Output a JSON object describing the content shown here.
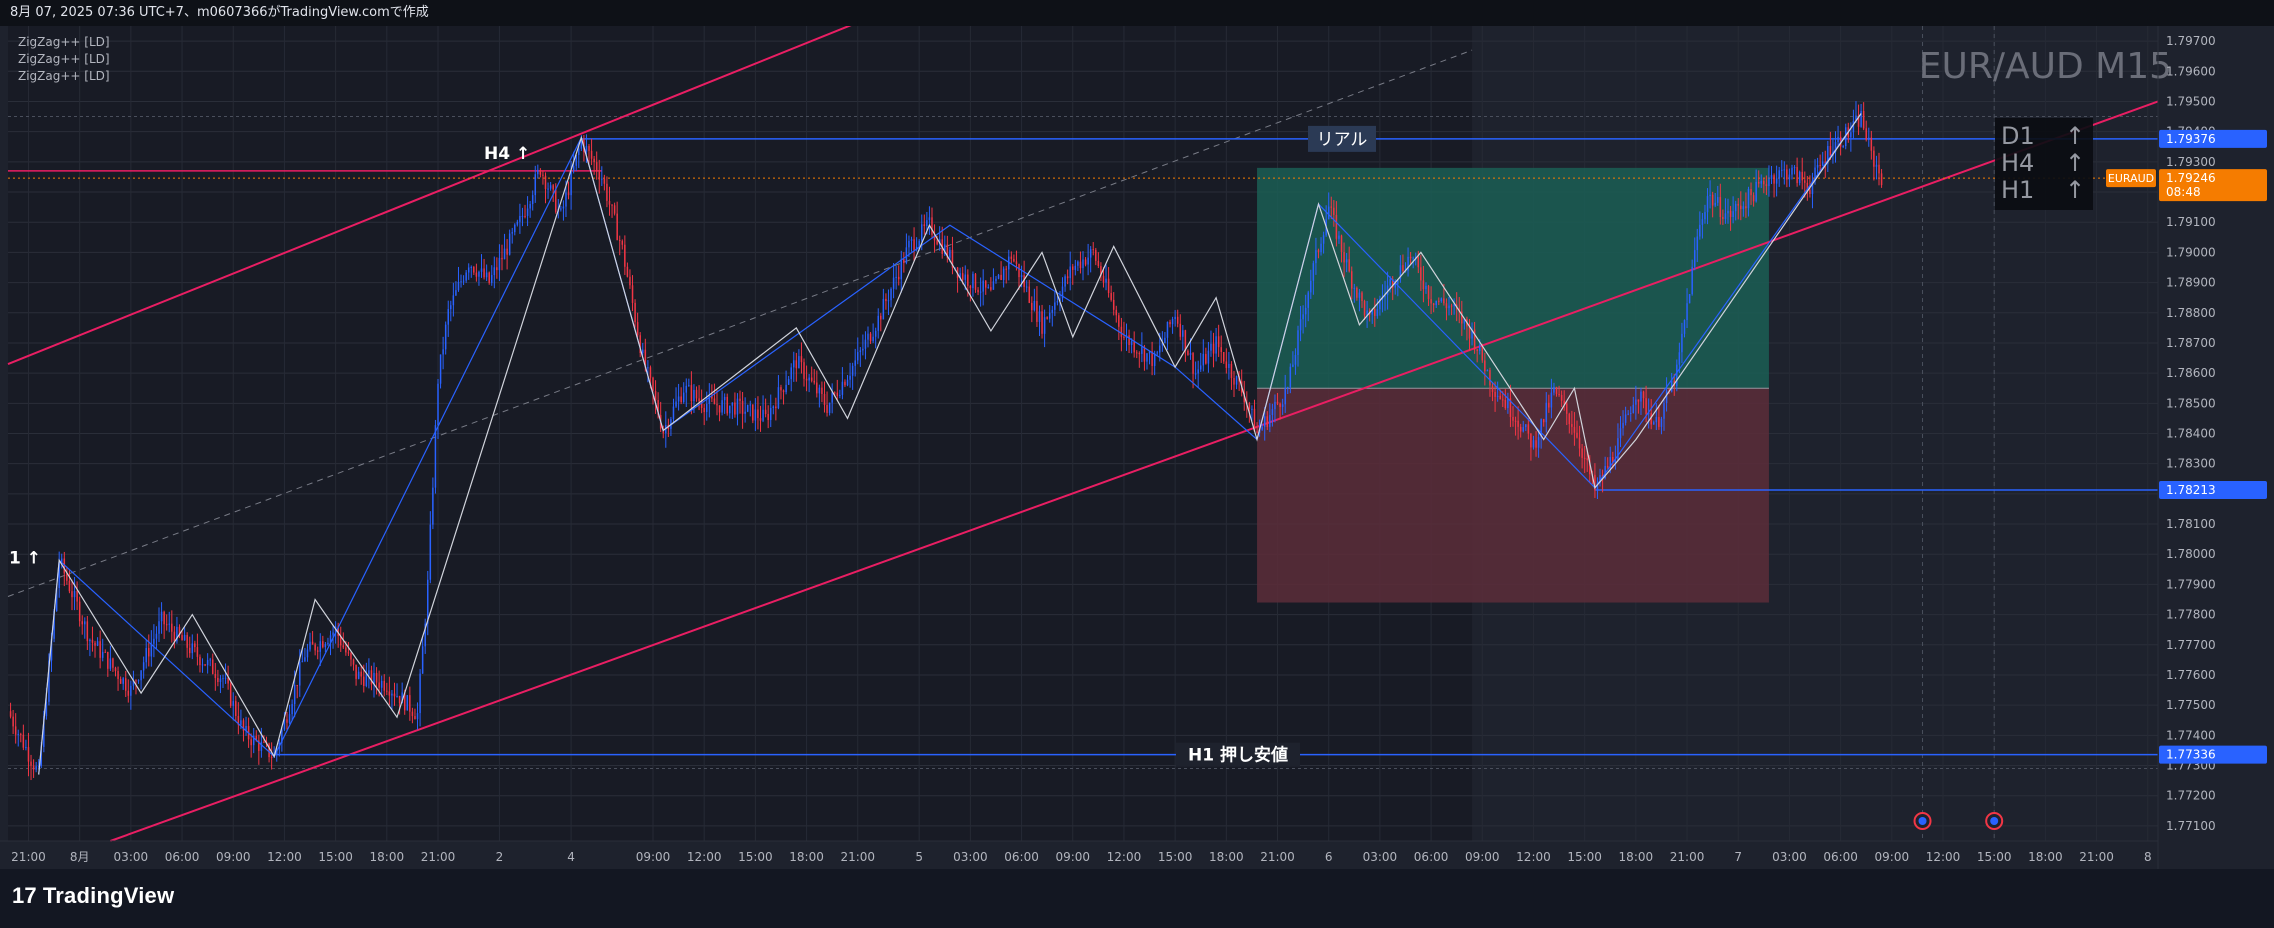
{
  "header": {
    "caption": "8月 07, 2025 07:36 UTC+7、m0607366がTradingView.comで作成"
  },
  "footer": {
    "brand": "TradingView",
    "brand_mark": "17"
  },
  "colors": {
    "background": "#1e222d",
    "up_candle": "#2962ff",
    "down_candle": "#f23645",
    "channel": "#e91e63",
    "zigzag_white": "#d1d4dc",
    "zigzag_blue": "#2962ff",
    "profit_zone": "#1b5e55",
    "loss_zone": "#5c2d3a",
    "price_tag_blue": "#2962ff",
    "price_tag_orange": "#f57c00"
  },
  "indicators": [
    "ZigZag++ [LD]",
    "ZigZag++ [LD]",
    "ZigZag++ [LD]"
  ],
  "watermark": "EUR/AUD M15",
  "trend_box": {
    "rows": [
      {
        "tf": "D1",
        "arrow": "↑"
      },
      {
        "tf": "H4",
        "arrow": "↑"
      },
      {
        "tf": "H1",
        "arrow": "↑"
      }
    ]
  },
  "annotations": {
    "h4_label": "H4 ↑",
    "h1_label_partial": "1 ↑",
    "real_label": "リアル",
    "support_label": "H1 押し安値"
  },
  "price_tags": {
    "h4_high": "1.79376",
    "current_symbol": "EURAUD",
    "current_price": "1.79246",
    "countdown": "08:48",
    "swing_low": "1.78213",
    "support": "1.77336"
  },
  "chart_data": {
    "type": "candlestick",
    "symbol": "EURAUD",
    "timeframe": "M15",
    "ylim": [
      1.7705,
      1.7975
    ],
    "y_ticks": [
      "1.79700",
      "1.79600",
      "1.79500",
      "1.79400",
      "1.79300",
      "1.79200",
      "1.79100",
      "1.79000",
      "1.78900",
      "1.78800",
      "1.78700",
      "1.78600",
      "1.78500",
      "1.78400",
      "1.78300",
      "1.78200",
      "1.78100",
      "1.78000",
      "1.77900",
      "1.77800",
      "1.77700",
      "1.77600",
      "1.77500",
      "1.77400",
      "1.77300",
      "1.77200",
      "1.77100"
    ],
    "x_ticks": [
      "21:00",
      "8月",
      "03:00",
      "06:00",
      "09:00",
      "12:00",
      "15:00",
      "18:00",
      "21:00",
      "2",
      "4",
      "09:00",
      "12:00",
      "15:00",
      "18:00",
      "21:00",
      "5",
      "03:00",
      "06:00",
      "09:00",
      "12:00",
      "15:00",
      "18:00",
      "21:00",
      "6",
      "03:00",
      "06:00",
      "09:00",
      "12:00",
      "15:00",
      "18:00",
      "21:00",
      "7",
      "03:00",
      "06:00",
      "09:00",
      "12:00",
      "15:00",
      "18:00",
      "21:00",
      "8"
    ],
    "x_tick_slots": [
      2,
      7,
      12,
      17,
      22,
      27,
      32,
      37,
      42,
      48,
      55,
      63,
      68,
      73,
      78,
      83,
      89,
      94,
      99,
      104,
      109,
      114,
      119,
      124,
      129,
      134,
      139,
      144,
      149,
      154,
      159,
      164,
      169,
      174,
      179,
      184,
      189,
      194,
      199,
      204,
      209
    ],
    "n_slots": 210,
    "price_path": [
      [
        0,
        1.7748
      ],
      [
        3,
        1.7727
      ],
      [
        5,
        1.7798
      ],
      [
        8,
        1.7772
      ],
      [
        12,
        1.7755
      ],
      [
        15,
        1.7778
      ],
      [
        18,
        1.7768
      ],
      [
        21,
        1.7759
      ],
      [
        23,
        1.7741
      ],
      [
        26,
        1.7733
      ],
      [
        29,
        1.7767
      ],
      [
        32,
        1.7775
      ],
      [
        34,
        1.776
      ],
      [
        37,
        1.7757
      ],
      [
        40,
        1.7747
      ],
      [
        41,
        1.779
      ],
      [
        42,
        1.7858
      ],
      [
        43,
        1.788
      ],
      [
        45,
        1.7897
      ],
      [
        47,
        1.789
      ],
      [
        50,
        1.791
      ],
      [
        52,
        1.7928
      ],
      [
        54,
        1.7912
      ],
      [
        56,
        1.7937
      ],
      [
        58,
        1.7925
      ],
      [
        60,
        1.7901
      ],
      [
        62,
        1.7865
      ],
      [
        64,
        1.7841
      ],
      [
        66,
        1.7855
      ],
      [
        68,
        1.785
      ],
      [
        71,
        1.7849
      ],
      [
        74,
        1.7845
      ],
      [
        77,
        1.7864
      ],
      [
        80,
        1.7849
      ],
      [
        83,
        1.7865
      ],
      [
        85,
        1.7878
      ],
      [
        88,
        1.7902
      ],
      [
        90,
        1.7909
      ],
      [
        93,
        1.7893
      ],
      [
        96,
        1.7886
      ],
      [
        98,
        1.7899
      ],
      [
        101,
        1.7876
      ],
      [
        104,
        1.7895
      ],
      [
        106,
        1.79
      ],
      [
        109,
        1.7872
      ],
      [
        112,
        1.7864
      ],
      [
        114,
        1.788
      ],
      [
        116,
        1.786
      ],
      [
        118,
        1.787
      ],
      [
        121,
        1.7851
      ],
      [
        122,
        1.784
      ],
      [
        125,
        1.7855
      ],
      [
        127,
        1.7888
      ],
      [
        129,
        1.7915
      ],
      [
        131,
        1.7893
      ],
      [
        133,
        1.7877
      ],
      [
        135,
        1.789
      ],
      [
        137,
        1.7899
      ],
      [
        139,
        1.7885
      ],
      [
        141,
        1.7882
      ],
      [
        143,
        1.7873
      ],
      [
        145,
        1.7856
      ],
      [
        147,
        1.7847
      ],
      [
        149,
        1.7836
      ],
      [
        151,
        1.7854
      ],
      [
        153,
        1.7842
      ],
      [
        155,
        1.7821
      ],
      [
        157,
        1.7834
      ],
      [
        159,
        1.7854
      ],
      [
        161,
        1.7843
      ],
      [
        163,
        1.786
      ],
      [
        165,
        1.7905
      ],
      [
        166,
        1.7919
      ],
      [
        168,
        1.7912
      ],
      [
        170,
        1.7918
      ],
      [
        172,
        1.7925
      ],
      [
        174,
        1.7927
      ],
      [
        176,
        1.7922
      ],
      [
        178,
        1.7935
      ],
      [
        180,
        1.794
      ],
      [
        181,
        1.7945
      ],
      [
        182,
        1.7932
      ],
      [
        183,
        1.7925
      ]
    ],
    "zigzag_white": [
      [
        3,
        1.7727
      ],
      [
        5,
        1.7798
      ],
      [
        13,
        1.7754
      ],
      [
        18,
        1.778
      ],
      [
        26,
        1.7733
      ],
      [
        30,
        1.7785
      ],
      [
        38,
        1.7746
      ],
      [
        56,
        1.7938
      ],
      [
        64,
        1.7841
      ],
      [
        77,
        1.7875
      ],
      [
        82,
        1.7845
      ],
      [
        90,
        1.7909
      ],
      [
        96,
        1.7874
      ],
      [
        101,
        1.79
      ],
      [
        104,
        1.7872
      ],
      [
        108,
        1.7902
      ],
      [
        114,
        1.7862
      ],
      [
        118,
        1.7885
      ],
      [
        122,
        1.7838
      ],
      [
        128,
        1.7916
      ],
      [
        132,
        1.7876
      ],
      [
        138,
        1.79
      ],
      [
        150,
        1.7838
      ],
      [
        153,
        1.7855
      ],
      [
        155,
        1.7822
      ],
      [
        159,
        1.7838
      ],
      [
        181,
        1.7946
      ]
    ],
    "zigzag_blue": [
      [
        3,
        1.7727
      ],
      [
        5,
        1.7798
      ],
      [
        26,
        1.7733
      ],
      [
        56,
        1.7938
      ],
      [
        64,
        1.7841
      ],
      [
        92,
        1.7909
      ],
      [
        114,
        1.7862
      ],
      [
        122,
        1.7838
      ],
      [
        128,
        1.7916
      ],
      [
        155,
        1.7822
      ],
      [
        181,
        1.7946
      ]
    ],
    "channel_upper": [
      [
        0,
        1.7863
      ],
      [
        88,
        1.7983
      ]
    ],
    "channel_lower": [
      [
        10,
        1.7705
      ],
      [
        210,
        1.795
      ]
    ],
    "channel_mid": [
      [
        0,
        1.7786
      ],
      [
        143,
        1.7967
      ]
    ],
    "position_box": {
      "x_start": 122,
      "x_end": 172,
      "entry": 1.7855,
      "target": 1.7928,
      "stop": 1.7784
    },
    "levels": [
      {
        "name": "h4_high",
        "value": 1.79376,
        "x_start": 56
      },
      {
        "name": "swing_low",
        "value": 1.78213,
        "x_start": 155
      },
      {
        "name": "support",
        "value": 1.77336,
        "x_start": 26
      }
    ],
    "current_price": 1.79246,
    "grid": true
  }
}
